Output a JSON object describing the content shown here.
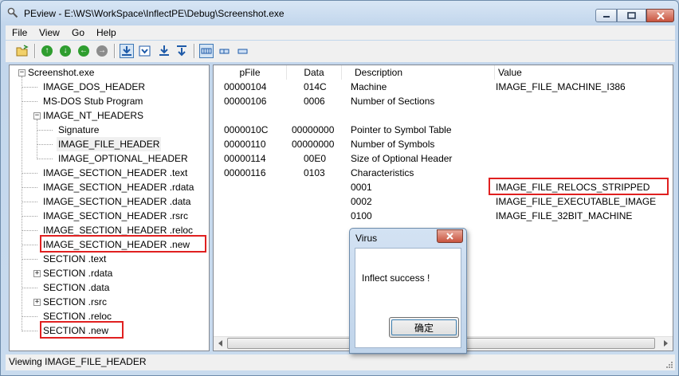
{
  "window": {
    "title": "PEview - E:\\WS\\WorkSpace\\InflectPE\\Debug\\Screenshot.exe"
  },
  "menu": [
    "File",
    "View",
    "Go",
    "Help"
  ],
  "toolbar": {
    "icons": [
      "open-folder-icon",
      "back-icon",
      "forward-icon",
      "previous-icon",
      "next-icon",
      "view-hex-icon",
      "view-bytes-icon",
      "view-words-icon",
      "view-dwords-icon",
      "view-details-icon",
      "view-list-icon",
      "view-small-icon"
    ]
  },
  "tree": {
    "items": [
      {
        "label": "Screenshot.exe"
      },
      {
        "label": "IMAGE_DOS_HEADER"
      },
      {
        "label": "MS-DOS Stub Program"
      },
      {
        "label": "IMAGE_NT_HEADERS"
      },
      {
        "label": "Signature"
      },
      {
        "label": "IMAGE_FILE_HEADER"
      },
      {
        "label": "IMAGE_OPTIONAL_HEADER"
      },
      {
        "label": "IMAGE_SECTION_HEADER .text"
      },
      {
        "label": "IMAGE_SECTION_HEADER .rdata"
      },
      {
        "label": "IMAGE_SECTION_HEADER .data"
      },
      {
        "label": "IMAGE_SECTION_HEADER .rsrc"
      },
      {
        "label": "IMAGE_SECTION_HEADER .reloc"
      },
      {
        "label": "IMAGE_SECTION_HEADER .new"
      },
      {
        "label": "SECTION .text"
      },
      {
        "label": "SECTION .rdata"
      },
      {
        "label": "SECTION .data"
      },
      {
        "label": "SECTION .rsrc"
      },
      {
        "label": "SECTION .reloc"
      },
      {
        "label": "SECTION .new"
      }
    ]
  },
  "table": {
    "columns": [
      "pFile",
      "Data",
      "Description",
      "Value"
    ],
    "rows": [
      [
        "00000104",
        "014C",
        "Machine",
        "IMAGE_FILE_MACHINE_I386"
      ],
      [
        "00000106",
        "0006",
        "Number of Sections",
        ""
      ],
      [
        "",
        "",
        "",
        ""
      ],
      [
        "0000010C",
        "00000000",
        "Pointer to Symbol Table",
        ""
      ],
      [
        "00000110",
        "00000000",
        "Number of Symbols",
        ""
      ],
      [
        "00000114",
        "00E0",
        "Size of Optional Header",
        ""
      ],
      [
        "00000116",
        "0103",
        "Characteristics",
        ""
      ],
      [
        "",
        "",
        "0001",
        "IMAGE_FILE_RELOCS_STRIPPED"
      ],
      [
        "",
        "",
        "0002",
        "IMAGE_FILE_EXECUTABLE_IMAGE"
      ],
      [
        "",
        "",
        "0100",
        "IMAGE_FILE_32BIT_MACHINE"
      ]
    ]
  },
  "status": {
    "text": "Viewing IMAGE_FILE_HEADER"
  },
  "dialog": {
    "title": "Virus",
    "message": "Inflect success !",
    "ok_label": "确定"
  },
  "colors": {
    "highlight_box": "#e02020",
    "window_frame": "#c2d6ec"
  }
}
